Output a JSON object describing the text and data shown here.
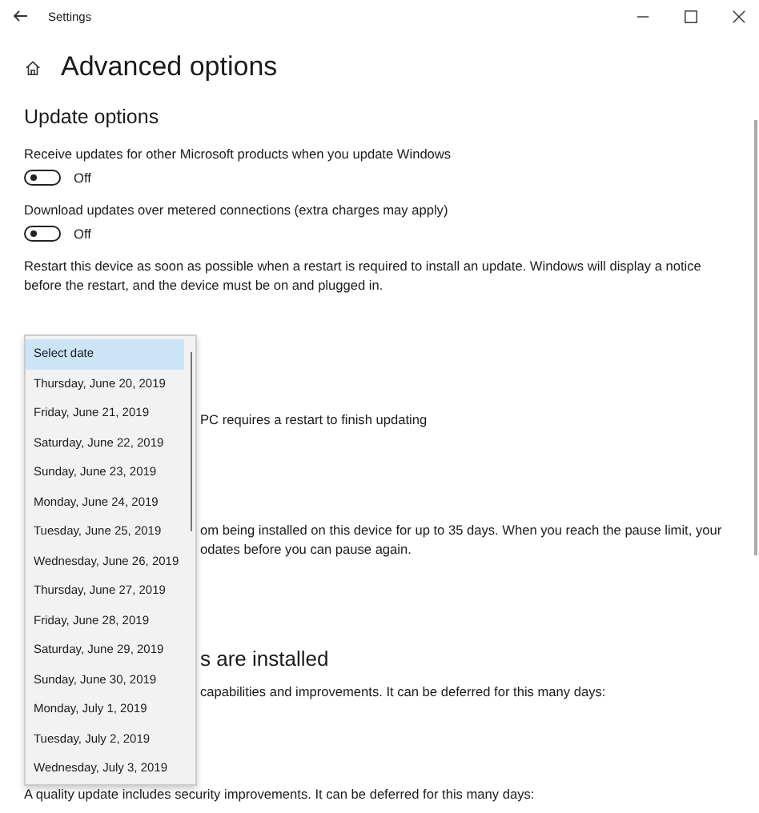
{
  "window": {
    "title": "Settings"
  },
  "page": {
    "title": "Advanced options"
  },
  "section": {
    "heading": "Update options"
  },
  "settings": [
    {
      "label": "Receive updates for other Microsoft products when you update Windows",
      "on": false,
      "state_label": "Off"
    },
    {
      "label": "Download updates over metered connections (extra charges may apply)",
      "on": false,
      "state_label": "Off"
    }
  ],
  "restart_note": "Restart this device as soon as possible when a restart is required to install an update. Windows will display a notice before the restart, and the device must be on and plugged in.",
  "obscured_lines": [
    {
      "kind": "text",
      "text": "PC requires a restart to finish updating"
    },
    {
      "kind": "text",
      "text": "om being installed on this device for up to 35 days. When you reach the pause limit, your"
    },
    {
      "kind": "text",
      "text": "odates before you can pause again."
    },
    {
      "kind": "heading",
      "text": "s are installed"
    },
    {
      "kind": "text",
      "text": "capabilities and improvements. It can be deferred for this many days:"
    }
  ],
  "quality_note": "A quality update includes security improvements. It can be deferred for this many days:",
  "date_dropdown": {
    "items": [
      {
        "label": "Select date",
        "selected": true
      },
      {
        "label": "Thursday, June 20, 2019",
        "selected": false
      },
      {
        "label": "Friday, June 21, 2019",
        "selected": false
      },
      {
        "label": "Saturday, June 22, 2019",
        "selected": false
      },
      {
        "label": "Sunday, June 23, 2019",
        "selected": false
      },
      {
        "label": "Monday, June 24, 2019",
        "selected": false
      },
      {
        "label": "Tuesday, June 25, 2019",
        "selected": false
      },
      {
        "label": "Wednesday, June 26, 2019",
        "selected": false
      },
      {
        "label": "Thursday, June 27, 2019",
        "selected": false
      },
      {
        "label": "Friday, June 28, 2019",
        "selected": false
      },
      {
        "label": "Saturday, June 29, 2019",
        "selected": false
      },
      {
        "label": "Sunday, June 30, 2019",
        "selected": false
      },
      {
        "label": "Monday, July 1, 2019",
        "selected": false
      },
      {
        "label": "Tuesday, July 2, 2019",
        "selected": false
      },
      {
        "label": "Wednesday, July 3, 2019",
        "selected": false
      }
    ]
  }
}
